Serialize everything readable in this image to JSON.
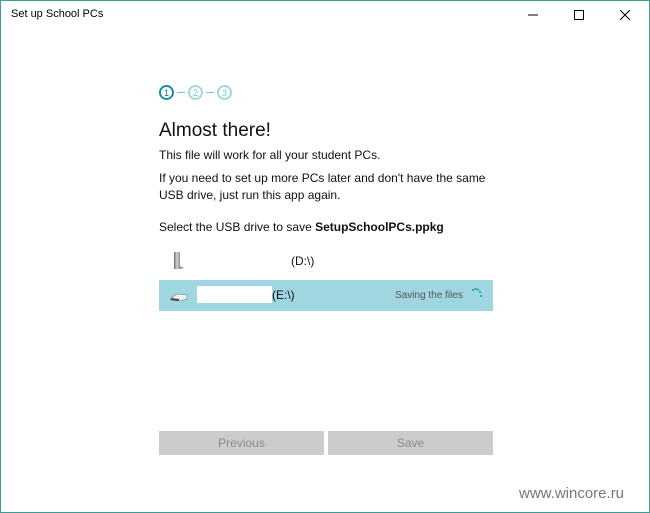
{
  "window": {
    "title": "Set up School PCs",
    "border_color": "#3a9e96"
  },
  "caption_buttons": {
    "minimize": "minimize-icon",
    "maximize": "maximize-icon",
    "close": "close-icon"
  },
  "steps": [
    {
      "label": "1",
      "state": "active"
    },
    {
      "label": "2",
      "state": "inactive"
    },
    {
      "label": "3",
      "state": "inactive"
    }
  ],
  "content": {
    "heading": "Almost there!",
    "line1": "This file will work for all your student PCs.",
    "line2": "If you need to set up more PCs later and don't have the same USB drive, just run this app again.",
    "select_prefix": "Select the USB drive to save ",
    "filename": "SetupSchoolPCs.ppkg"
  },
  "drives": [
    {
      "icon": "usb-stick-icon",
      "name": "",
      "letter": "(D:\\)",
      "selected": false,
      "status": ""
    },
    {
      "icon": "usb-drive-icon",
      "name": "",
      "letter": "(E:\\)",
      "selected": true,
      "status": "Saving the files"
    }
  ],
  "buttons": {
    "previous": "Previous",
    "save": "Save",
    "disabled": true
  },
  "colors": {
    "accent": "#1b8ca6",
    "selected_row": "#9fd6e0",
    "button_disabled_bg": "#cccccc",
    "button_disabled_text": "#8a8a8a"
  },
  "watermark": "www.wincore.ru"
}
